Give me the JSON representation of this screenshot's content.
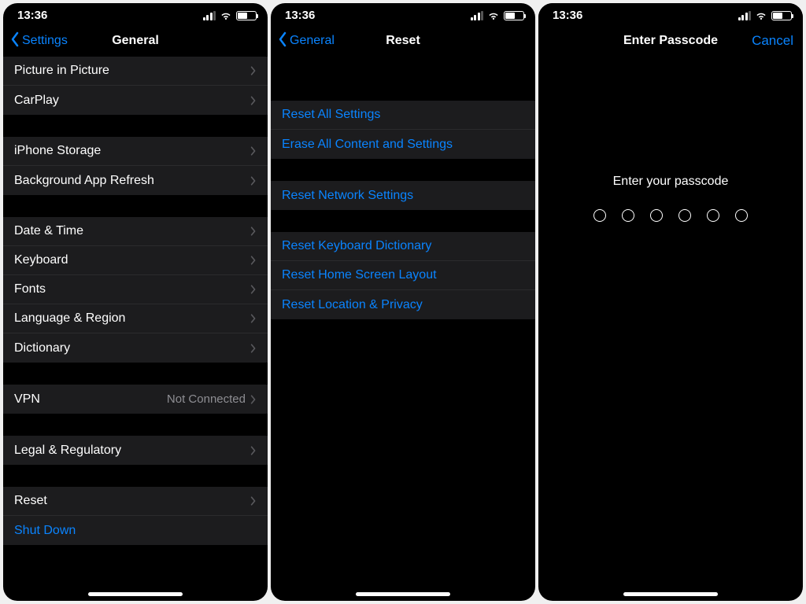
{
  "status": {
    "time": "13:36"
  },
  "panel1": {
    "back": "Settings",
    "title": "General",
    "groups": [
      {
        "items": [
          {
            "label": "Picture in Picture",
            "chevron": true
          },
          {
            "label": "CarPlay",
            "chevron": true
          }
        ]
      },
      {
        "items": [
          {
            "label": "iPhone Storage",
            "chevron": true
          },
          {
            "label": "Background App Refresh",
            "chevron": true
          }
        ]
      },
      {
        "items": [
          {
            "label": "Date & Time",
            "chevron": true
          },
          {
            "label": "Keyboard",
            "chevron": true
          },
          {
            "label": "Fonts",
            "chevron": true
          },
          {
            "label": "Language & Region",
            "chevron": true
          },
          {
            "label": "Dictionary",
            "chevron": true
          }
        ]
      },
      {
        "items": [
          {
            "label": "VPN",
            "detail": "Not Connected",
            "chevron": true
          }
        ]
      },
      {
        "items": [
          {
            "label": "Legal & Regulatory",
            "chevron": true
          }
        ]
      },
      {
        "items": [
          {
            "label": "Reset",
            "chevron": true
          },
          {
            "label": "Shut Down",
            "blue": true,
            "chevron": false
          }
        ]
      }
    ]
  },
  "panel2": {
    "back": "General",
    "title": "Reset",
    "groups": [
      {
        "items": [
          {
            "label": "Reset All Settings",
            "blue": true
          },
          {
            "label": "Erase All Content and Settings",
            "blue": true
          }
        ]
      },
      {
        "items": [
          {
            "label": "Reset Network Settings",
            "blue": true
          }
        ]
      },
      {
        "items": [
          {
            "label": "Reset Keyboard Dictionary",
            "blue": true
          },
          {
            "label": "Reset Home Screen Layout",
            "blue": true
          },
          {
            "label": "Reset Location & Privacy",
            "blue": true
          }
        ]
      }
    ]
  },
  "panel3": {
    "title": "Enter Passcode",
    "cancel": "Cancel",
    "prompt": "Enter your passcode",
    "digits": 6
  }
}
